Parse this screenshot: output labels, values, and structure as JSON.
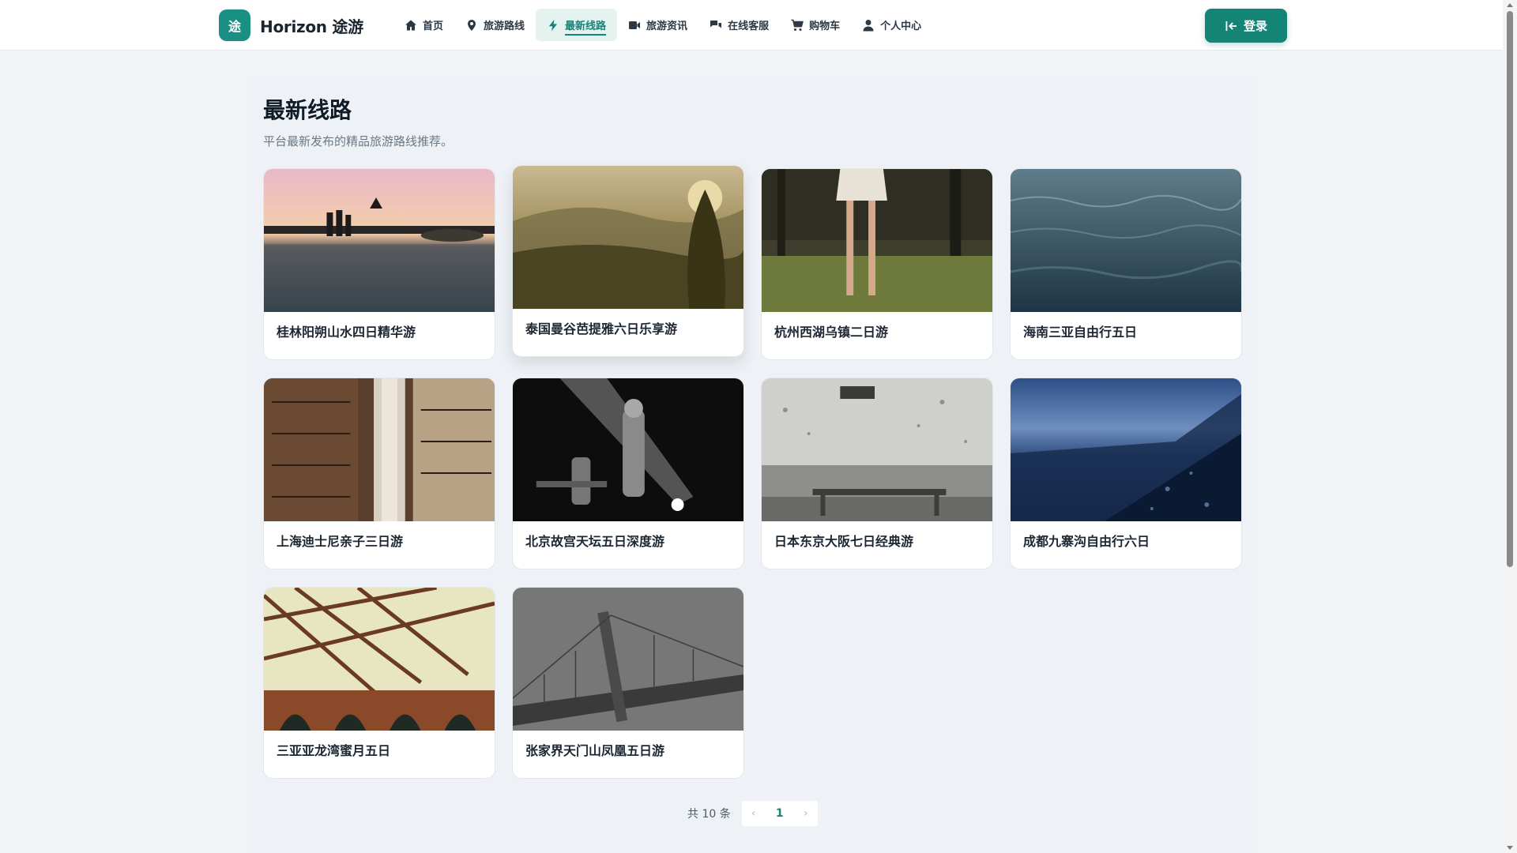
{
  "app": {
    "logo_char": "途",
    "brand_name": "Horizon 途游"
  },
  "nav": [
    {
      "label": "首页",
      "icon": "home-icon",
      "active": false
    },
    {
      "label": "旅游路线",
      "icon": "map-pin-icon",
      "active": false
    },
    {
      "label": "最新线路",
      "icon": "bolt-icon",
      "active": true
    },
    {
      "label": "旅游资讯",
      "icon": "video-icon",
      "active": false
    },
    {
      "label": "在线客服",
      "icon": "chat-icon",
      "active": false
    },
    {
      "label": "购物车",
      "icon": "cart-icon",
      "active": false
    },
    {
      "label": "个人中心",
      "icon": "user-icon",
      "active": false
    }
  ],
  "header": {
    "login_label": "登录"
  },
  "main": {
    "title": "最新线路",
    "subtitle": "平台最新发布的精品旅游路线推荐。"
  },
  "routes": [
    {
      "title": "桂林阳朔山水四日精华游"
    },
    {
      "title": "泰国曼谷芭提雅六日乐享游"
    },
    {
      "title": "杭州西湖乌镇二日游"
    },
    {
      "title": "海南三亚自由行五日"
    },
    {
      "title": "上海迪士尼亲子三日游"
    },
    {
      "title": "北京故宫天坛五日深度游"
    },
    {
      "title": "日本东京大阪七日经典游"
    },
    {
      "title": "成都九寨沟自由行六日"
    },
    {
      "title": "三亚亚龙湾蜜月五日"
    },
    {
      "title": "张家界天门山凤凰五日游"
    }
  ],
  "pagination": {
    "total_text": "共 10 条",
    "current_page": "1",
    "prev_glyph": "‹",
    "next_glyph": "›"
  },
  "colors": {
    "accent": "#148477",
    "accent_light": "#e4f3f0",
    "page_bg": "#f1f4f7"
  }
}
